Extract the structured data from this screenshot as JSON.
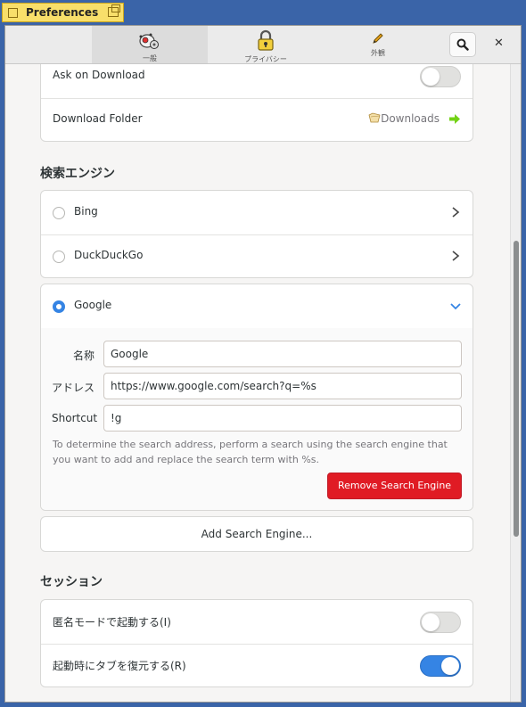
{
  "titlebar": {
    "title": "Preferences"
  },
  "header": {
    "tabs": [
      {
        "label": "一般",
        "icon": "general-icon",
        "active": true
      },
      {
        "label": "プライバシー",
        "icon": "lock-icon",
        "active": false
      },
      {
        "label": "外観",
        "icon": "pencil-icon",
        "active": false
      }
    ],
    "search_icon": "search-icon",
    "close_icon": "close-icon"
  },
  "downloads": {
    "ask_label": "Ask on Download",
    "ask_enabled": false,
    "folder_label": "Download Folder",
    "folder_value": "Downloads"
  },
  "search_engines": {
    "title": "検索エンジン",
    "engines": [
      {
        "name": "Bing",
        "selected": false
      },
      {
        "name": "DuckDuckGo",
        "selected": false
      },
      {
        "name": "Google",
        "selected": true
      }
    ],
    "form": {
      "name_label": "名称",
      "name_value": "Google",
      "address_label": "アドレス",
      "address_value": "https://www.google.com/search?q=%s",
      "shortcut_label": "Shortcut",
      "shortcut_value": "!g",
      "hint": "To determine the search address, perform a search using the search engine that you want to add and replace the search term with %s.",
      "remove_label": "Remove Search Engine"
    },
    "add_label": "Add Search Engine..."
  },
  "session": {
    "title": "セッション",
    "incognito_label": "匿名モードで起動する(I)",
    "incognito_enabled": false,
    "restore_label": "起動時にタブを復元する(R)",
    "restore_enabled": true
  },
  "colors": {
    "accent": "#3584e4",
    "destructive": "#e01b24",
    "titlebar": "#3a64a8",
    "title_tab": "#f8df6a"
  }
}
